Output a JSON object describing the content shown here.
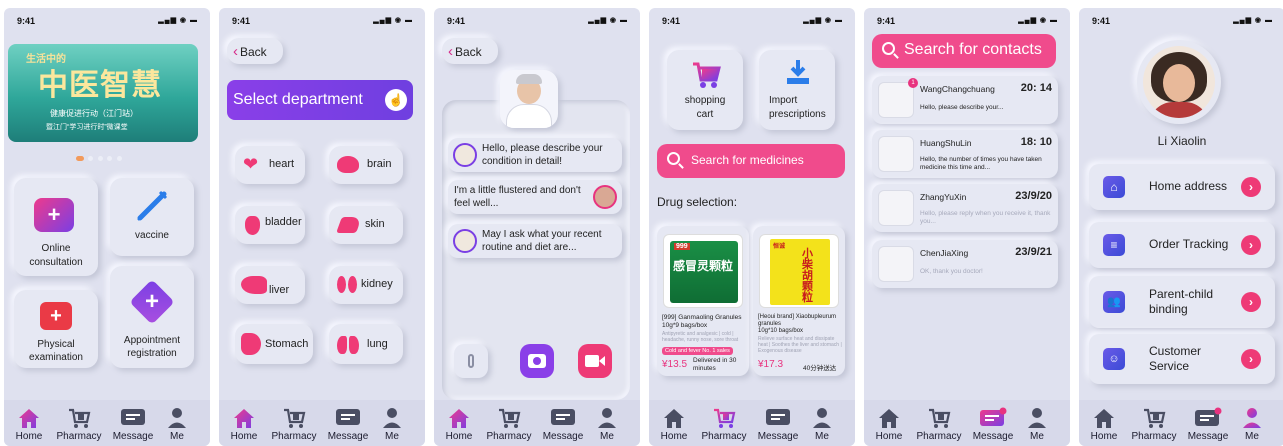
{
  "status": {
    "time": "9:41"
  },
  "tabs": {
    "home": "Home",
    "pharmacy": "Pharmacy",
    "message": "Message",
    "me": "Me"
  },
  "s1": {
    "banner_script_top": "生活中的",
    "banner_title": "中医智慧",
    "banner_line1": "健康促进行动（江门站）",
    "banner_line2": "暨江门“学习进行时”微课堂",
    "tiles": {
      "online": "Online\nconsultation",
      "vaccine": "vaccine",
      "physical": "Physical\nexamination",
      "appointment": "Appointment\nregistration"
    }
  },
  "s2": {
    "back": "Back",
    "header": "Select department",
    "depts": [
      "heart",
      "brain",
      "bladder",
      "skin",
      "liver",
      "kidney",
      "Stomach",
      "lung"
    ]
  },
  "s3": {
    "back": "Back",
    "msg1": "Hello, please describe your condition in detail!",
    "msg2": "I'm a little flustered and don't feel well...",
    "msg3": "May I ask what your recent routine and diet are..."
  },
  "s4": {
    "cart": "shopping\ncart",
    "import": "Import\nprescriptions",
    "search": "Search for medicines",
    "drug_selection": "Drug selection:",
    "drug1": {
      "box_brand": "999",
      "box_text": "感冒灵颗粒",
      "name": "[999] Ganmaoling Granules\n10g*9 bags/box",
      "desc": "Antipyretic and analgesic | cold | headache, runny nose, sore throat",
      "badge": "Cold and fever No. 1 sales",
      "price": "¥13.5",
      "delivery": "Delivered in 30\nminutes"
    },
    "drug2": {
      "box_brand": "恒诚",
      "box_text": "小柴胡颗粒",
      "name": "[Heoui brand] Xiaobupleurum\ngranules\n10g*10 bags/box",
      "desc": "Relieve surface heat and dissipate heat | Soothes the liver and stomach | Exogenous disease",
      "price": "¥17.3",
      "delivery": "40分钟送达"
    }
  },
  "s5": {
    "search": "Search for contacts",
    "contacts": [
      {
        "name": "WangChangchuang",
        "time": "20: 14",
        "msg": "Hello, please describe your...",
        "badge": "1"
      },
      {
        "name": "HuangShuLin",
        "time": "18: 10",
        "msg": "Hello, the number of times you have taken medicine this time and..."
      },
      {
        "name": "ZhangYuXin",
        "time": "23/9/20",
        "msg": "Hello, please reply when you receive it, thank you..."
      },
      {
        "name": "ChenJiaXing",
        "time": "23/9/21",
        "msg": "OK, thank you doctor!"
      }
    ]
  },
  "s6": {
    "user": "Li Xiaolin",
    "menu": [
      "Home address",
      "Order Tracking",
      "Parent-child\nbinding",
      "Customer\nService"
    ]
  },
  "colors": {
    "accent": "#e8337f",
    "purple": "#7b3fe4",
    "bg": "#dfe1ef"
  }
}
